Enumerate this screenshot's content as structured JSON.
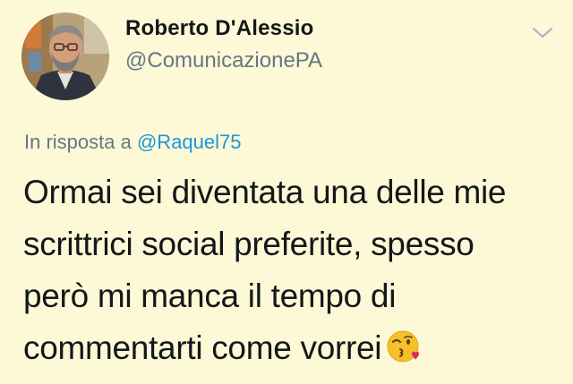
{
  "author": {
    "name": "Roberto D'Alessio",
    "handle": "@ComunicazionePA"
  },
  "reply": {
    "prefix": "In risposta a",
    "mention": "@Raquel75"
  },
  "tweet": {
    "line1": "Ormai sei diventata una delle mie",
    "line2": "scrittrici social preferite, spesso",
    "line3": "però mi manca il tempo di",
    "line4": "commentarti come vorrei",
    "emoji_icon": "kissing-face-heart-emoji"
  },
  "colors": {
    "background": "#fdf9d6",
    "name": "#14171a",
    "muted": "#657786",
    "link": "#1b95e0"
  },
  "icons": {
    "menu": "chevron-down-icon"
  }
}
